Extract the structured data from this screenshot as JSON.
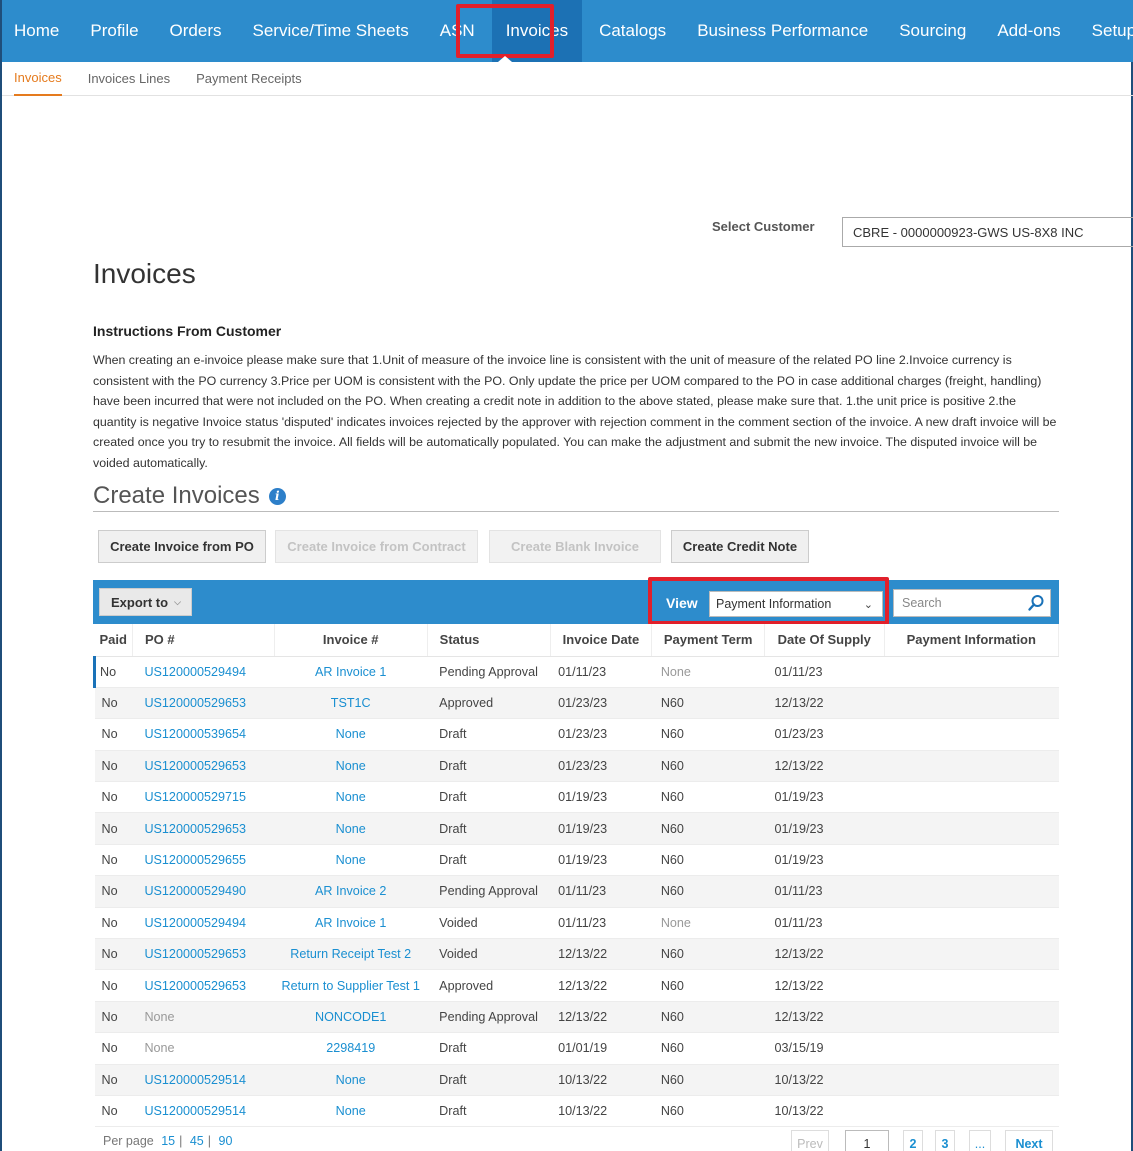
{
  "nav": {
    "items": [
      "Home",
      "Profile",
      "Orders",
      "Service/Time Sheets",
      "ASN",
      "Invoices",
      "Catalogs",
      "Business Performance",
      "Sourcing",
      "Add-ons",
      "Setup"
    ],
    "active": "Invoices"
  },
  "subnav": {
    "items": [
      "Invoices",
      "Invoices Lines",
      "Payment Receipts"
    ],
    "active": "Invoices"
  },
  "customer": {
    "label": "Select Customer",
    "value": "CBRE - 0000000923-GWS US-8X8 INC"
  },
  "page_title": "Invoices",
  "instructions": {
    "heading": "Instructions From Customer",
    "body": "When creating an e-invoice please make sure that 1.Unit of measure of the invoice line is consistent with the unit of measure of the related PO line 2.Invoice currency is consistent with the PO currency 3.Price per UOM is consistent with the PO. Only update the price per UOM compared to the PO in case additional charges (freight, handling) have been incurred that were not included on the PO. When creating a credit note in addition to the above stated, please make sure that. 1.the unit price is positive 2.the quantity is negative Invoice status 'disputed' indicates invoices rejected by the approver with rejection comment in the comment section of the invoice. A new draft invoice will be created once you try to resubmit the invoice. All fields will be automatically populated. You can make the adjustment and submit the new invoice. The disputed invoice will be voided automatically."
  },
  "create": {
    "title": "Create Invoices",
    "buttons": {
      "from_po": "Create Invoice from PO",
      "from_contract": "Create Invoice from Contract",
      "blank": "Create Blank Invoice",
      "credit_note": "Create Credit Note"
    }
  },
  "toolbar": {
    "export_label": "Export to",
    "view_label": "View",
    "view_value": "Payment Information",
    "search_placeholder": "Search"
  },
  "table": {
    "headers": [
      "Paid",
      "PO #",
      "Invoice #",
      "Status",
      "Invoice Date",
      "Payment Term",
      "Date Of Supply",
      "Payment Information"
    ],
    "rows": [
      [
        "No",
        "US120000529494",
        "AR Invoice 1",
        "Pending Approval",
        "01/11/23",
        "None",
        "01/11/23",
        ""
      ],
      [
        "No",
        "US120000529653",
        "TST1C",
        "Approved",
        "01/23/23",
        "N60",
        "12/13/22",
        ""
      ],
      [
        "No",
        "US120000539654",
        "None",
        "Draft",
        "01/23/23",
        "N60",
        "01/23/23",
        ""
      ],
      [
        "No",
        "US120000529653",
        "None",
        "Draft",
        "01/23/23",
        "N60",
        "12/13/22",
        ""
      ],
      [
        "No",
        "US120000529715",
        "None",
        "Draft",
        "01/19/23",
        "N60",
        "01/19/23",
        ""
      ],
      [
        "No",
        "US120000529653",
        "None",
        "Draft",
        "01/19/23",
        "N60",
        "01/19/23",
        ""
      ],
      [
        "No",
        "US120000529655",
        "None",
        "Draft",
        "01/19/23",
        "N60",
        "01/19/23",
        ""
      ],
      [
        "No",
        "US120000529490",
        "AR Invoice 2",
        "Pending Approval",
        "01/11/23",
        "N60",
        "01/11/23",
        ""
      ],
      [
        "No",
        "US120000529494",
        "AR Invoice 1",
        "Voided",
        "01/11/23",
        "None",
        "01/11/23",
        ""
      ],
      [
        "No",
        "US120000529653",
        "Return Receipt Test 2",
        "Voided",
        "12/13/22",
        "N60",
        "12/13/22",
        ""
      ],
      [
        "No",
        "US120000529653",
        "Return to Supplier Test 1",
        "Approved",
        "12/13/22",
        "N60",
        "12/13/22",
        ""
      ],
      [
        "No",
        "None",
        "NONCODE1",
        "Pending Approval",
        "12/13/22",
        "N60",
        "12/13/22",
        ""
      ],
      [
        "No",
        "None",
        "2298419",
        "Draft",
        "01/01/19",
        "N60",
        "03/15/19",
        ""
      ],
      [
        "No",
        "US120000529514",
        "None",
        "Draft",
        "10/13/22",
        "N60",
        "10/13/22",
        ""
      ],
      [
        "No",
        "US120000529514",
        "None",
        "Draft",
        "10/13/22",
        "N60",
        "10/13/22",
        ""
      ]
    ]
  },
  "pagination": {
    "per_page_label": "Per page",
    "per_page_options": [
      "15",
      "45",
      "90"
    ],
    "separator": "|",
    "prev": "Prev",
    "current": "1",
    "pages": [
      "2",
      "3"
    ],
    "ellipsis": "...",
    "next": "Next"
  },
  "colors": {
    "nav_bg": "#2d8ccc",
    "nav_active": "#1c71b4",
    "highlight_outline": "#e1202b",
    "link": "#1a8fd1",
    "subnav_active": "#e57b1e"
  }
}
